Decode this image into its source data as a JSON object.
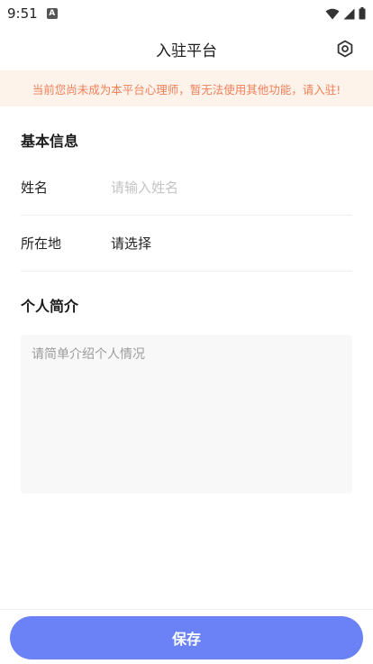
{
  "status_bar": {
    "time": "9:51",
    "app_badge": "A",
    "icons": [
      "wifi-icon",
      "signal-icon",
      "battery-icon"
    ]
  },
  "nav": {
    "title": "入驻平台",
    "settings_icon": "settings-icon"
  },
  "notice": {
    "text": "当前您尚未成为本平台心理师，暂无法使用其他功能，请入驻!"
  },
  "basic_info": {
    "title": "基本信息",
    "name_label": "姓名",
    "name_value": "",
    "name_placeholder": "请输入姓名",
    "location_label": "所在地",
    "location_value": "请选择"
  },
  "intro": {
    "title": "个人简介",
    "value": "",
    "placeholder": "请简单介绍个人情况"
  },
  "actions": {
    "save_label": "保存"
  },
  "colors": {
    "accent": "#6b82f6",
    "notice_bg": "#fdf3ea",
    "notice_text": "#f0805a"
  }
}
